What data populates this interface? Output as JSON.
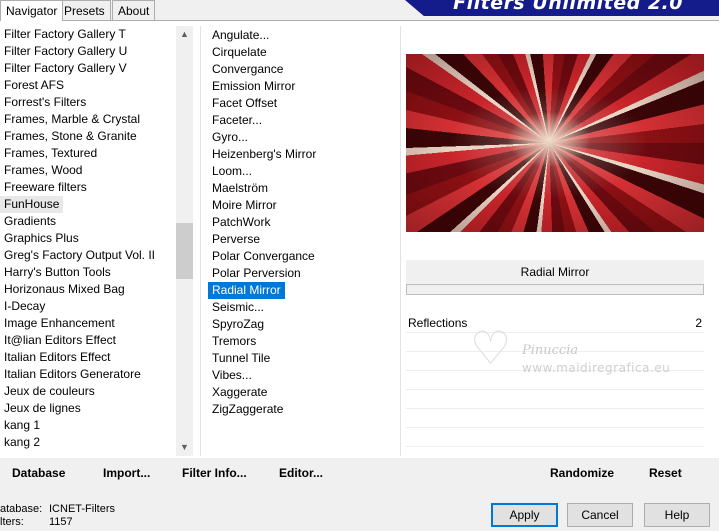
{
  "tabs": [
    {
      "label": "Navigator",
      "active": true
    },
    {
      "label": "Presets",
      "active": false
    },
    {
      "label": "About",
      "active": false
    }
  ],
  "banner": {
    "title": "Filters Unlimited 2.0"
  },
  "categories": [
    "Filter Factory Gallery T",
    "Filter Factory Gallery U",
    "Filter Factory Gallery V",
    "Forest AFS",
    "Forrest's Filters",
    "Frames, Marble & Crystal",
    "Frames, Stone & Granite",
    "Frames, Textured",
    "Frames, Wood",
    "Freeware filters",
    "FunHouse",
    "Gradients",
    "Graphics Plus",
    "Greg's Factory Output Vol. II",
    "Harry's Button Tools",
    "Horizonaus Mixed Bag",
    "I-Decay",
    "Image Enhancement",
    "It@lian Editors Effect",
    "Italian Editors Effect",
    "Italian Editors Generatore",
    "Jeux de couleurs",
    "Jeux de lignes",
    "kang 1",
    "kang 2"
  ],
  "selected_category": "FunHouse",
  "filters": [
    "Angulate...",
    "Cirquelate",
    "Convergance",
    "Emission Mirror",
    "Facet Offset",
    "Faceter...",
    "Gyro...",
    "Heizenberg's Mirror",
    "Loom...",
    "Maelström",
    "Moire Mirror",
    "PatchWork",
    "Perverse",
    "Polar Convergance",
    "Polar Perversion",
    "Radial Mirror",
    "Seismic...",
    "SpyroZag",
    "Tremors",
    "Tunnel Tile",
    "Vibes...",
    "Xaggerate",
    "ZigZaggerate"
  ],
  "selected_filter": "Radial Mirror",
  "panel": {
    "filter_name": "Radial Mirror",
    "params": [
      {
        "label": "Reflections",
        "value": "2"
      }
    ]
  },
  "watermark": {
    "name": "Pinuccia",
    "url": "www.maidiregrafica.eu"
  },
  "toolbar": {
    "database": "Database",
    "import": "Import...",
    "filter_info": "Filter Info...",
    "editor": "Editor...",
    "randomize": "Randomize",
    "reset": "Reset"
  },
  "status": {
    "db_label": "atabase:",
    "db_value": "ICNET-Filters",
    "filters_label": "lters:",
    "filters_value": "1157"
  },
  "buttons": {
    "apply": "Apply",
    "cancel": "Cancel",
    "help": "Help"
  },
  "colors": {
    "selection": "#0078d7",
    "banner": "#141c8c"
  }
}
